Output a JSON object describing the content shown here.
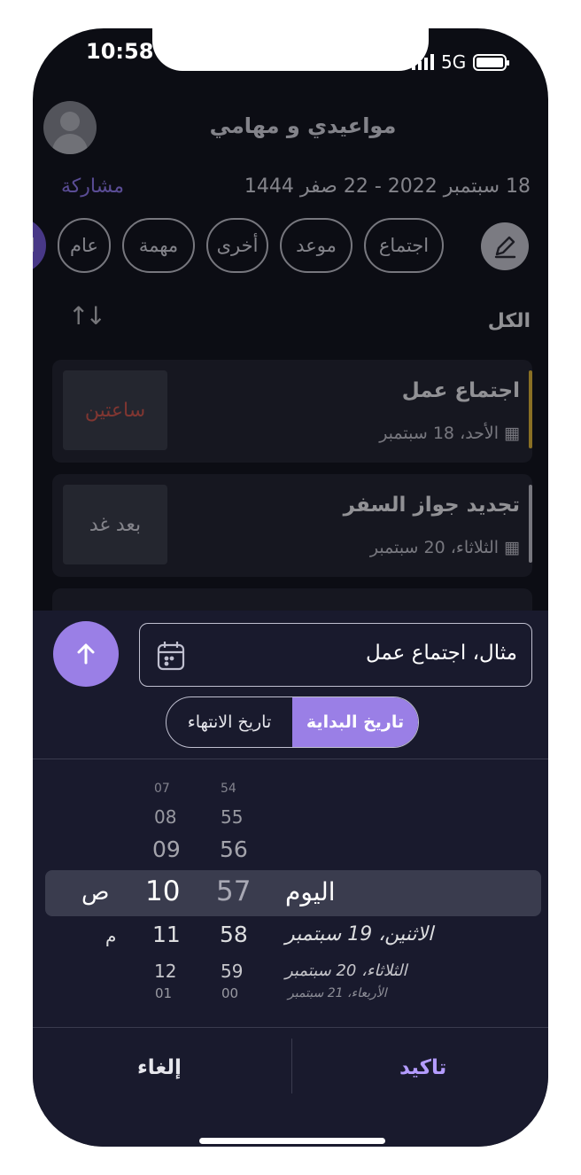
{
  "status": {
    "time": "10:58",
    "network": "5G"
  },
  "header": {
    "title": "مواعيدي و مهامي",
    "dates": "18 سبتمبر 2022 - 22 صفر 1444",
    "share": "مشاركة"
  },
  "filters": [
    "الكل",
    "عام",
    "مهمة",
    "أخرى",
    "موعد",
    "اجتماع"
  ],
  "section_title": "الكل",
  "cards": [
    {
      "title": "اجتماع عمل",
      "date": "الأحد، 18 سبتمبر",
      "tag": "ساعتين",
      "tag_color": "#e05a4a",
      "bar_color": "#f0c132"
    },
    {
      "title": "تجديد جواز السفر",
      "date": "الثلاثاء، 20 سبتمبر",
      "tag": "بعد غد",
      "tag_color": "#e6e6ec",
      "bar_color": "#cfcfd6"
    }
  ],
  "input": {
    "placeholder": "مثال، اجتماع عمل"
  },
  "segments": {
    "start": "تاريخ البداية",
    "end": "تاريخ الانتهاء"
  },
  "picker": {
    "hours": [
      "07",
      "08",
      "09",
      "10",
      "11",
      "12",
      "01"
    ],
    "minutes": [
      "54",
      "55",
      "56",
      "57",
      "58",
      "59",
      "00"
    ],
    "days": [
      "اليوم",
      "الاثنين، 19 سبتمبر",
      "الثلاثاء، 20 سبتمبر",
      "الأربعاء، 21 سبتمبر"
    ],
    "ampm": [
      "ص",
      "م"
    ]
  },
  "footer": {
    "cancel": "إلغاء",
    "confirm": "تاكيد"
  }
}
